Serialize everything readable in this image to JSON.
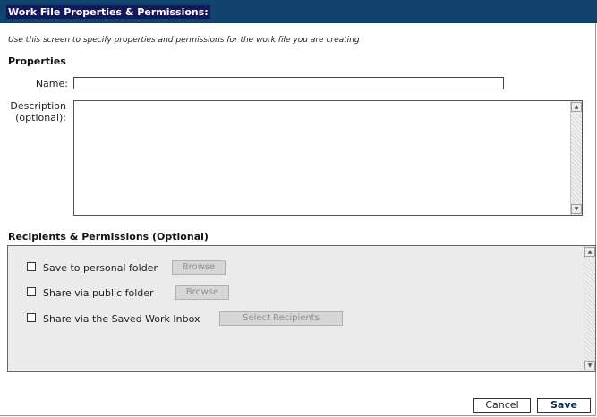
{
  "header": {
    "title": "Work File Properties & Permissions:"
  },
  "intro_text": "Use this screen to specify properties and permissions for the work file you are creating",
  "properties": {
    "heading": "Properties",
    "name_label": "Name:",
    "name_value": "",
    "description_label_1": "Description",
    "description_label_2": "(optional):",
    "description_value": ""
  },
  "permissions": {
    "heading": "Recipients & Permissions (Optional)",
    "options": [
      {
        "label": "Save to personal folder",
        "checked": false,
        "button": "Browse"
      },
      {
        "label": "Share via public folder",
        "checked": false,
        "button": "Browse"
      },
      {
        "label": "Share via the Saved Work Inbox",
        "checked": false,
        "button": "Select Recipients"
      }
    ]
  },
  "footer": {
    "cancel_label": "Cancel",
    "save_label": "Save"
  },
  "icons": {
    "scroll_up": "scroll-up-arrow-icon",
    "scroll_down": "scroll-down-arrow-icon"
  },
  "colors": {
    "header_bg": "#10446e",
    "title_bg": "#13185a"
  }
}
